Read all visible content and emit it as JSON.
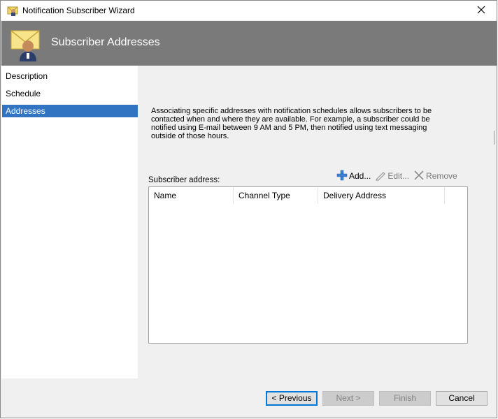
{
  "window": {
    "title": "Notification Subscriber Wizard",
    "icon": "subscriber-wizard-icon",
    "close_icon": "close-icon"
  },
  "header": {
    "title": "Subscriber Addresses",
    "icon": "envelope-user-icon",
    "background": "#7a7a7a"
  },
  "sidebar": {
    "items": [
      {
        "label": "Description",
        "selected": false
      },
      {
        "label": "Schedule",
        "selected": false
      },
      {
        "label": "Addresses",
        "selected": true
      }
    ],
    "selected_color": "#3074c2"
  },
  "main": {
    "description": "Associating specific addresses with notification schedules allows subscribers to be contacted when and where they are available. For example, a subscriber could be notified using E-mail between 9 AM and 5 PM, then notified using text messaging outside of those hours.",
    "address_label": "Subscriber address:",
    "toolbar": {
      "add": {
        "label": "Add...",
        "icon": "add-icon",
        "enabled": true
      },
      "edit": {
        "label": "Edit...",
        "icon": "pencil-icon",
        "enabled": false
      },
      "remove": {
        "label": "Remove",
        "icon": "x-icon",
        "enabled": false
      }
    },
    "table": {
      "columns": [
        "Name",
        "Channel Type",
        "Delivery Address"
      ],
      "rows": []
    }
  },
  "footer": {
    "previous": "< Previous",
    "next": "Next >",
    "finish": "Finish",
    "cancel": "Cancel"
  }
}
